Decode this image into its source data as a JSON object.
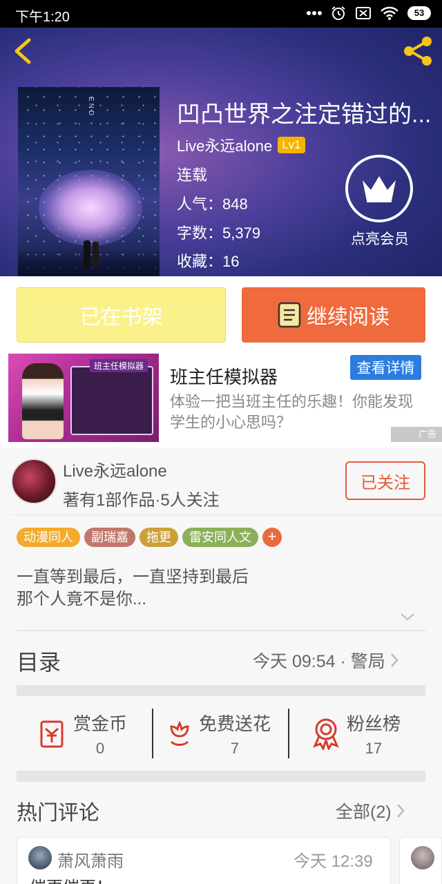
{
  "status_bar": {
    "time": "下午1:20",
    "battery": "53"
  },
  "book": {
    "title": "凹凸世界之注定错过的...",
    "author": "Live永远alone",
    "level": "Lv1",
    "status": "连载",
    "popularity": "人气：848",
    "words": "字数：5,379",
    "favorites": "收藏：16",
    "cover_text": "END"
  },
  "vip": {
    "label": "点亮会员"
  },
  "actions": {
    "shelf_label": "已在书架",
    "read_label": "继续阅读"
  },
  "ad": {
    "title": "班主任模拟器",
    "detail_label": "查看详情",
    "description": "体验一把当班主任的乐趣！你能发现学生的小心思吗？",
    "tag": "广告",
    "image_title": "班主任模拟器"
  },
  "author_card": {
    "name": "Live永远alone",
    "meta": "著有1部作品·5人关注",
    "follow_label": "已关注"
  },
  "tags": [
    {
      "label": "动漫同人",
      "color": "#f2ab2c"
    },
    {
      "label": "副瑞嘉",
      "color": "#c0786a"
    },
    {
      "label": "拖更",
      "color": "#caa03a"
    },
    {
      "label": "雷安同人文",
      "color": "#8bb05a"
    }
  ],
  "tag_add": "+",
  "description": {
    "line1": "一直等到最后，一直坚持到最后",
    "line2": "那个人竟不是你..."
  },
  "toc": {
    "title": "目录",
    "update": "今天 09:54 · 警局"
  },
  "stats": [
    {
      "label": "赏金币",
      "value": "0",
      "icon": "red-envelope-icon"
    },
    {
      "label": "免费送花",
      "value": "7",
      "icon": "flower-icon"
    },
    {
      "label": "粉丝榜",
      "value": "17",
      "icon": "medal-icon"
    }
  ],
  "hot_comments": {
    "title": "热门评论",
    "all_label": "全部(2)",
    "items": [
      {
        "name": "萧风萧雨",
        "time": "今天 12:39",
        "text": "催更催更！"
      }
    ]
  },
  "colors": {
    "accent": "#ef6a3d",
    "shelf": "#fbf18a",
    "ad_button": "#2c7de0",
    "gold": "#f5b400"
  }
}
